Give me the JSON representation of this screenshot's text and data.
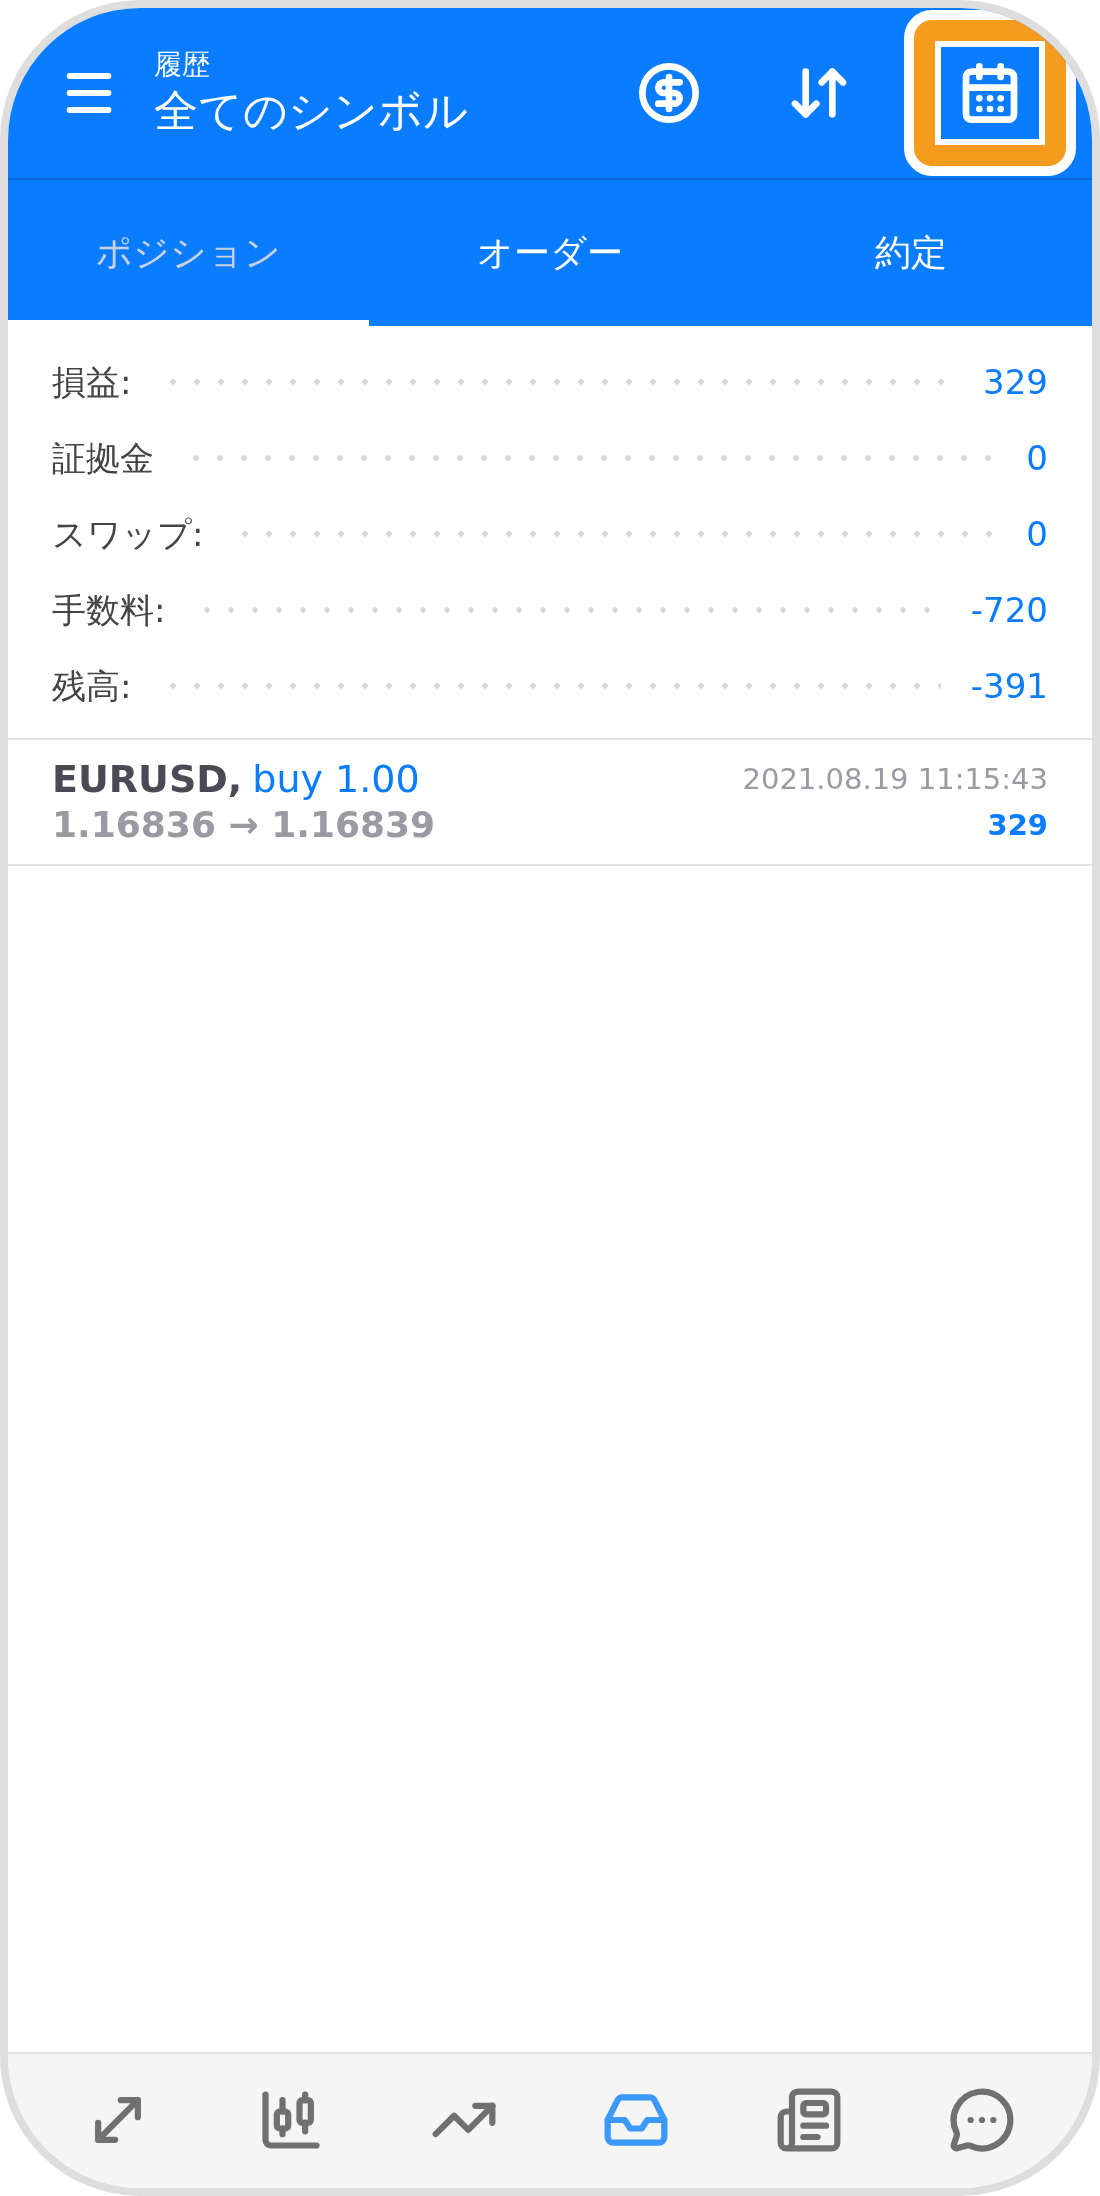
{
  "header": {
    "subtitle": "履歴",
    "title": "全てのシンボル",
    "actions": [
      {
        "kind": "currency",
        "highlighted": false
      },
      {
        "kind": "sort",
        "highlighted": false
      },
      {
        "kind": "calendar",
        "highlighted": true
      }
    ]
  },
  "tabs": [
    {
      "label": "ポジション",
      "selected": true
    },
    {
      "label": "オーダー",
      "selected": false
    },
    {
      "label": "約定",
      "selected": false
    }
  ],
  "summary": [
    {
      "label": "損益:",
      "value": "329"
    },
    {
      "label": "証拠金",
      "value": "0"
    },
    {
      "label": "スワップ:",
      "value": "0"
    },
    {
      "label": "手数料:",
      "value": "-720"
    },
    {
      "label": "残高:",
      "value": "-391"
    }
  ],
  "deals": [
    {
      "symbol": "EURUSD,",
      "side": "buy 1.00",
      "prices": "1.16836 → 1.16839",
      "time": "2021.08.19 11:15:43",
      "profit": "329"
    }
  ],
  "bottom_nav": [
    {
      "kind": "trade",
      "selected": false
    },
    {
      "kind": "quotes",
      "selected": false
    },
    {
      "kind": "chart",
      "selected": false
    },
    {
      "kind": "history",
      "selected": true
    },
    {
      "kind": "news",
      "selected": false
    },
    {
      "kind": "chat",
      "selected": false
    }
  ]
}
